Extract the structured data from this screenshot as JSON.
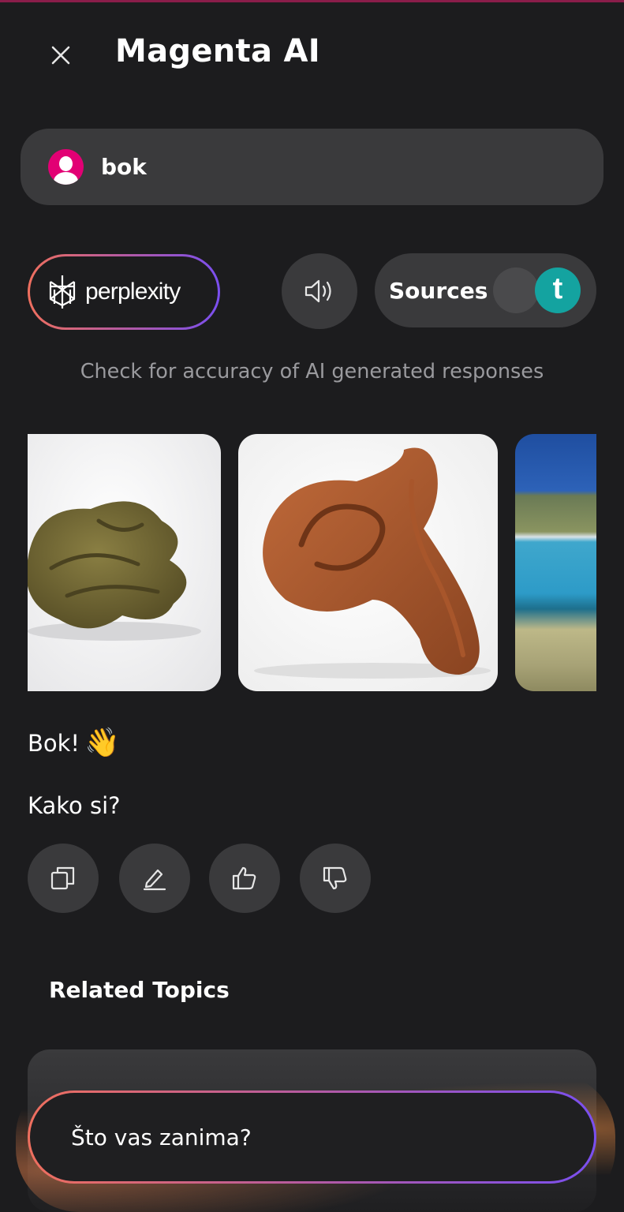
{
  "header": {
    "title": "Magenta AI",
    "close_icon": "close-icon"
  },
  "query": {
    "text": "bok",
    "avatar_icon": "user-avatar-icon",
    "avatar_color": "#e20074"
  },
  "controls": {
    "perplexity_label": "perplexity",
    "perplexity_icon": "perplexity-logo-icon",
    "speaker_icon": "speaker-icon",
    "sources_label": "Sources",
    "sources_toggle_on": true,
    "sources_toggle_icon": "t-logo-icon",
    "toggle_color": "#14a3a0"
  },
  "disclaimer": "Check for accuracy of AI generated responses",
  "images": [
    {
      "name": "image-result-1",
      "subject": "brown-object-photo"
    },
    {
      "name": "image-result-2",
      "subject": "brown-object-photo"
    },
    {
      "name": "image-result-3",
      "subject": "sea-coast-photo"
    }
  ],
  "answer": {
    "line1": "Bok!",
    "emoji": "👋",
    "line2": "Kako si?"
  },
  "actions": [
    {
      "name": "copy-button",
      "icon": "copy-icon"
    },
    {
      "name": "edit-button",
      "icon": "pencil-icon"
    },
    {
      "name": "thumbs-up-button",
      "icon": "thumbs-up-icon"
    },
    {
      "name": "thumbs-down-button",
      "icon": "thumbs-down-icon"
    }
  ],
  "related_topics_heading": "Related Topics",
  "input": {
    "placeholder": "Što vas zanima?"
  },
  "colors": {
    "background": "#1c1c1e",
    "pill": "#3a3a3c",
    "accent_gradient": [
      "#ef6f5e",
      "#b45aa2",
      "#7a4ff0"
    ]
  }
}
